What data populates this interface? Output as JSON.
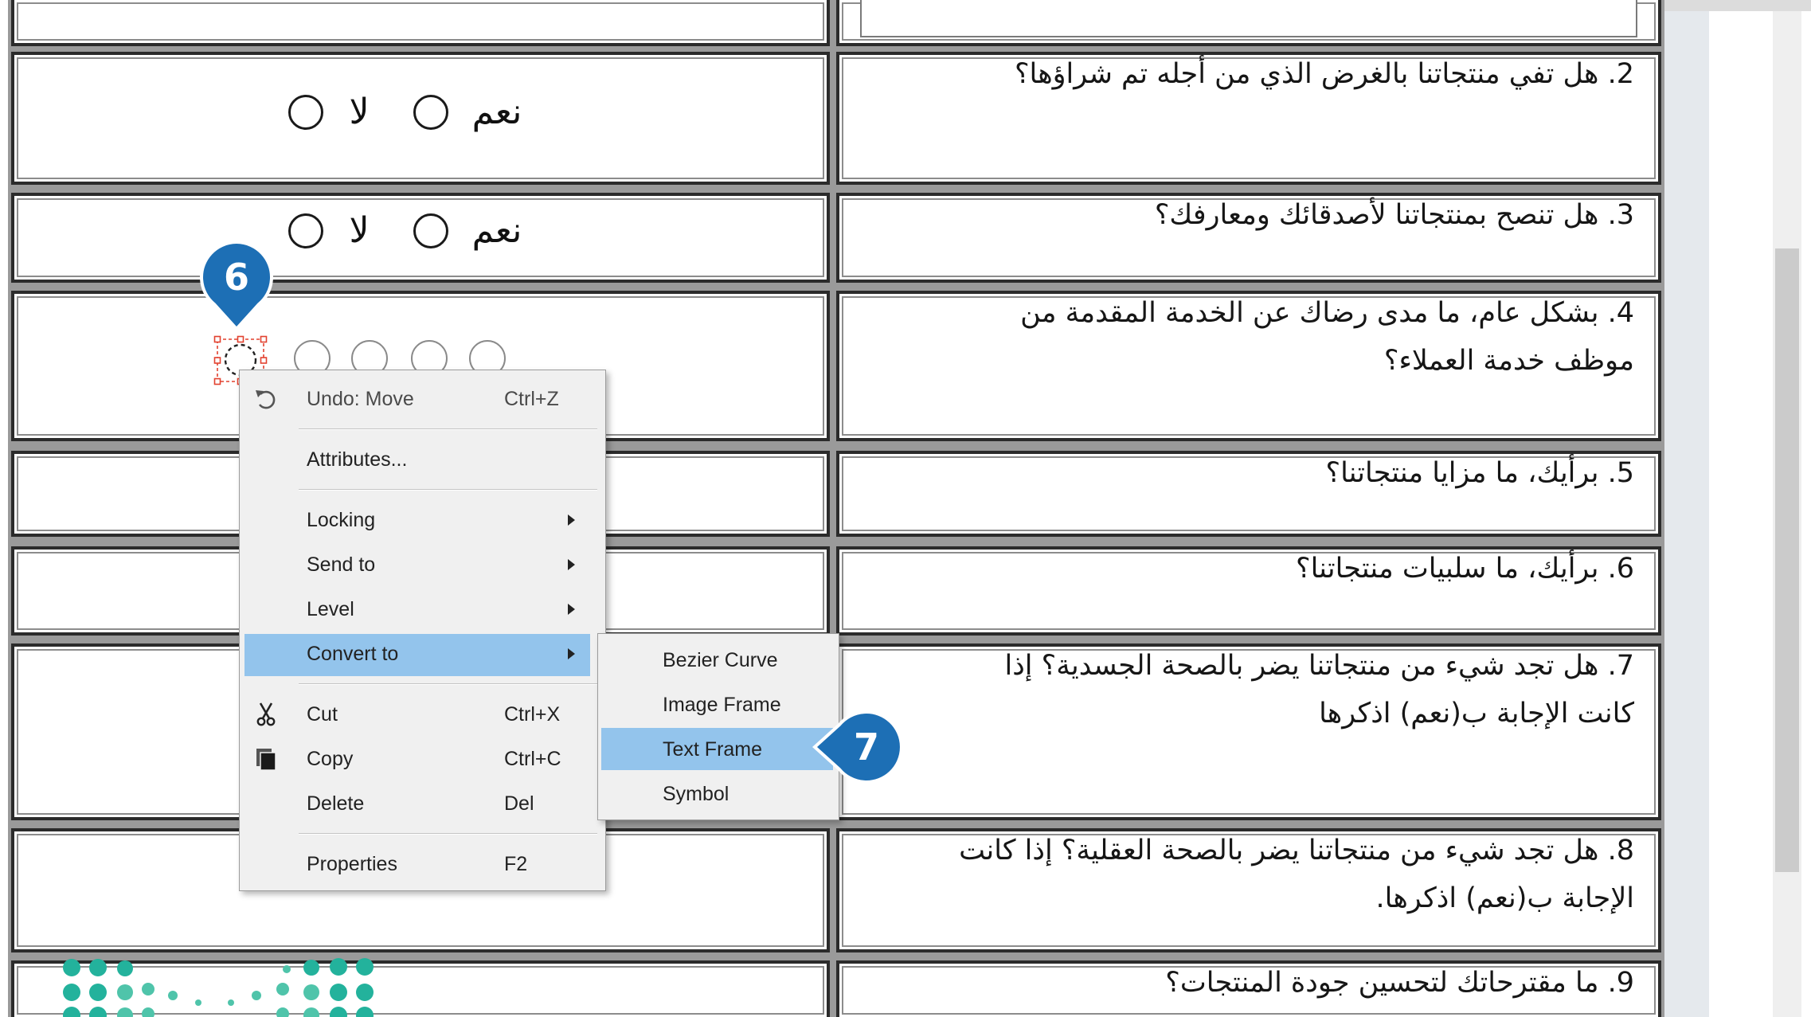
{
  "survey": {
    "yes_label": "نعم",
    "no_label": "لا",
    "questions": [
      {
        "lines": [
          "2. هل تفي منتجاتنا بالغرض الذي من أجله تم شراؤها؟"
        ]
      },
      {
        "lines": [
          "3. هل تنصح بمنتجاتنا لأصدقائك ومعارفك؟"
        ]
      },
      {
        "lines": [
          "4. بشكل عام، ما مدى رضاك عن الخدمة المقدمة من",
          "موظف خدمة العملاء؟"
        ]
      },
      {
        "lines": [
          "5. برأيك، ما مزايا منتجاتنا؟"
        ]
      },
      {
        "lines": [
          "6. برأيك، ما سلبيات منتجاتنا؟"
        ]
      },
      {
        "lines": [
          "7. هل تجد شيء من منتجاتنا يضر بالصحة الجسدية؟ إذا",
          "كانت الإجابة ب(نعم) اذكرها"
        ]
      },
      {
        "lines": [
          "8. هل تجد شيء من منتجاتنا يضر بالصحة العقلية؟ إذا كانت",
          "الإجابة ب(نعم) اذكرها."
        ]
      },
      {
        "lines": [
          "9. ما مقترحاتك لتحسين جودة المنتجات؟"
        ]
      }
    ]
  },
  "context_menu": {
    "items": [
      {
        "type": "item",
        "label": "Undo: Move",
        "shortcut": "Ctrl+Z",
        "icon": "undo-icon"
      },
      {
        "type": "separator"
      },
      {
        "type": "item",
        "label": "Attributes..."
      },
      {
        "type": "separator"
      },
      {
        "type": "item",
        "label": "Locking",
        "has_submenu": true
      },
      {
        "type": "item",
        "label": "Send to",
        "has_submenu": true
      },
      {
        "type": "item",
        "label": "Level",
        "has_submenu": true
      },
      {
        "type": "item",
        "label": "Convert to",
        "has_submenu": true,
        "highlighted": true
      },
      {
        "type": "separator"
      },
      {
        "type": "item",
        "label": "Cut",
        "shortcut": "Ctrl+X",
        "icon": "scissors-icon"
      },
      {
        "type": "item",
        "label": "Copy",
        "shortcut": "Ctrl+C",
        "icon": "copy-icon"
      },
      {
        "type": "item",
        "label": "Delete",
        "shortcut": "Del"
      },
      {
        "type": "separator"
      },
      {
        "type": "item",
        "label": "Properties",
        "shortcut": "F2"
      }
    ]
  },
  "submenu": {
    "items": [
      {
        "label": "Bezier Curve"
      },
      {
        "label": "Image Frame"
      },
      {
        "label": "Text Frame",
        "highlighted": true
      },
      {
        "label": "Symbol"
      }
    ]
  },
  "callouts": [
    {
      "label": "6"
    },
    {
      "label": "7"
    }
  ],
  "colors": {
    "callout": "#1d6fb5",
    "menu_highlight": "#93c4ec",
    "selection_handles": "#e2412f",
    "logo_primary": "#23b29c",
    "logo_secondary": "#4fc4aa"
  }
}
